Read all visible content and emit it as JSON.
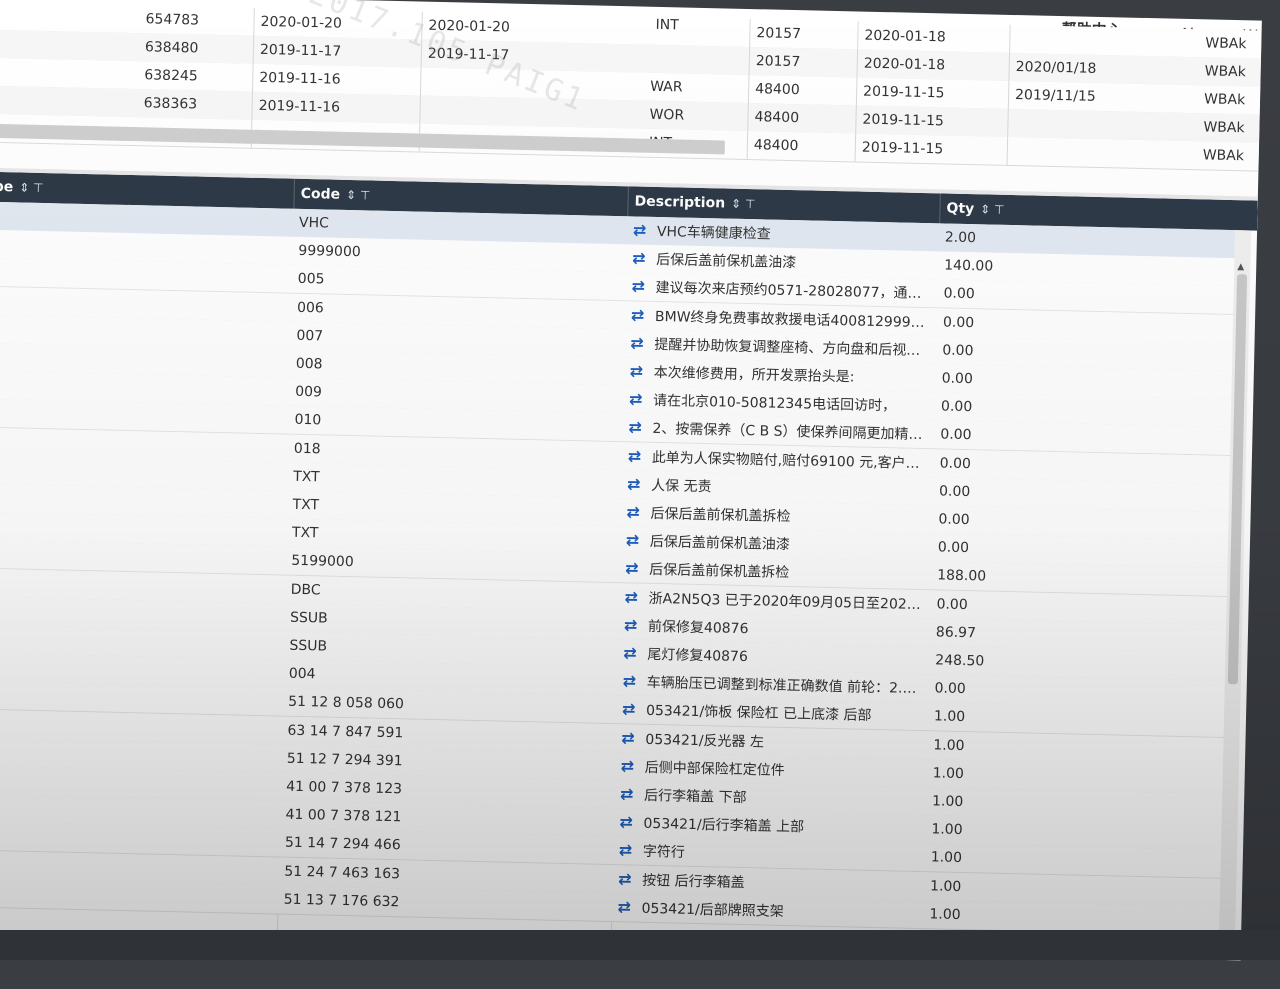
{
  "topbar": {
    "help_label": "帮助中心",
    "user_name": "Alex.we.Wang"
  },
  "top_rows": [
    {
      "num": "654783",
      "date1": "2020-01-20",
      "date2": "2020-01-20",
      "type": "INT",
      "code": "20157",
      "date3": "2020-01-18",
      "date4": "",
      "vin": "WBAk"
    },
    {
      "num": "638480",
      "date1": "2019-11-17",
      "date2": "2019-11-17",
      "type": "",
      "code": "20157",
      "date3": "2020-01-18",
      "date4": "2020/01/18",
      "vin": "WBAk"
    },
    {
      "num": "638245",
      "date1": "2019-11-16",
      "date2": "",
      "type": "WAR",
      "code": "48400",
      "date3": "2019-11-15",
      "date4": "2019/11/15",
      "vin": "WBAk"
    },
    {
      "num": "638363",
      "date1": "2019-11-16",
      "date2": "",
      "type": "WOR",
      "code": "48400",
      "date3": "2019-11-15",
      "date4": "",
      "vin": "WBAk"
    },
    {
      "num": "",
      "date1": "",
      "date2": "",
      "type": "INT",
      "code": "48400",
      "date3": "2019-11-15",
      "date4": "",
      "vin": "WBAk"
    }
  ],
  "watermark": "2017.105 PAIG1",
  "columns": {
    "left_partial": "pe",
    "code": "Code",
    "description": "Description",
    "qty": "Qty",
    "sort_glyph": "⇕ ⊤"
  },
  "rows": [
    {
      "code": "VHC",
      "desc": "VHC车辆健康检查",
      "qty": "2.00"
    },
    {
      "code": "9999000",
      "desc": "后保后盖前保机盖油漆",
      "qty": "140.00"
    },
    {
      "code": "005",
      "desc": "建议每次来店预约0571-28028077，通过…",
      "qty": "0.00"
    },
    {
      "code": "006",
      "desc": "BMW终身免费事故救援电话4008129999…",
      "qty": "0.00"
    },
    {
      "code": "007",
      "desc": "提醒并协助恢复调整座椅、方向盘和后视镜…",
      "qty": "0.00"
    },
    {
      "code": "008",
      "desc": "本次维修费用，所开发票抬头是:",
      "qty": "0.00"
    },
    {
      "code": "009",
      "desc": "请在北京010-50812345电话回访时，",
      "qty": "0.00"
    },
    {
      "code": "010",
      "desc": "2、按需保养（C B S）使保养间隔更加精…",
      "qty": "0.00"
    },
    {
      "code": "018",
      "desc": "此单为人保实物赔付,赔付69100 元,客户承…",
      "qty": "0.00"
    },
    {
      "code": "TXT",
      "desc": "人保 无责",
      "qty": "0.00"
    },
    {
      "code": "TXT",
      "desc": "后保后盖前保机盖拆检",
      "qty": "0.00"
    },
    {
      "code": "TXT",
      "desc": "后保后盖前保机盖油漆",
      "qty": "0.00"
    },
    {
      "code": "5199000",
      "desc": "后保后盖前保机盖拆检",
      "qty": "188.00"
    },
    {
      "code": "DBC",
      "desc": "浙A2N5Q3 已于2020年09月05日至2020…",
      "qty": "0.00"
    },
    {
      "code": "SSUB",
      "desc": "前保修复40876",
      "qty": "86.97"
    },
    {
      "code": "SSUB",
      "desc": "尾灯修复40876",
      "qty": "248.50"
    },
    {
      "code": "004",
      "desc": "车辆胎压已调整到标准正确数值 前轮：2.3…",
      "qty": "0.00"
    },
    {
      "code": "51 12 8 058 060",
      "desc": "053421/饰板 保险杠 已上底漆 后部",
      "qty": "1.00"
    },
    {
      "code": "63 14 7 847 591",
      "desc": "053421/反光器 左",
      "qty": "1.00"
    },
    {
      "code": "51 12 7 294 391",
      "desc": "后侧中部保险杠定位件",
      "qty": "1.00"
    },
    {
      "code": "41 00 7 378 123",
      "desc": "后行李箱盖 下部",
      "qty": "1.00"
    },
    {
      "code": "41 00 7 378 121",
      "desc": "053421/后行李箱盖 上部",
      "qty": "1.00"
    },
    {
      "code": "51 14 7 294 466",
      "desc": "字符行",
      "qty": "1.00"
    },
    {
      "code": "51 24 7 463 163",
      "desc": "按钮 后行李箱盖",
      "qty": "1.00"
    },
    {
      "code": "51 13 7 176 632",
      "desc": "053421/后部牌照支架",
      "qty": "1.00"
    }
  ]
}
